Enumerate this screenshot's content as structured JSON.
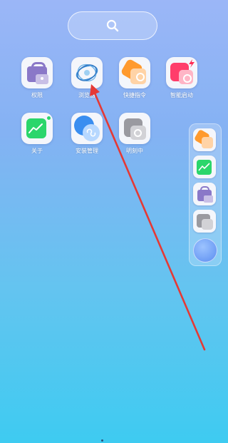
{
  "search": {
    "icon": "search-icon"
  },
  "apps": [
    {
      "label": "权限",
      "icon": "bag-lock-icon"
    },
    {
      "label": "浏览器",
      "icon": "swirl-browser-icon"
    },
    {
      "label": "快捷指令",
      "icon": "shortcut-hex-icon"
    },
    {
      "label": "智能启动",
      "icon": "smart-launch-icon"
    },
    {
      "label": "关于",
      "icon": "about-chart-icon"
    },
    {
      "label": "安装管理",
      "icon": "install-manager-icon"
    },
    {
      "label": "明刻中",
      "icon": "gray-app-icon"
    }
  ],
  "dock": {
    "items": [
      "shortcut-hex-icon",
      "about-chart-icon",
      "bag-lock-icon",
      "gray-app-icon"
    ],
    "circle_icon": "blue-circle-icon"
  },
  "colors": {
    "background_top": "#9bb6f7",
    "background_bottom": "#3ecbf1",
    "arrow": "#e53935"
  }
}
